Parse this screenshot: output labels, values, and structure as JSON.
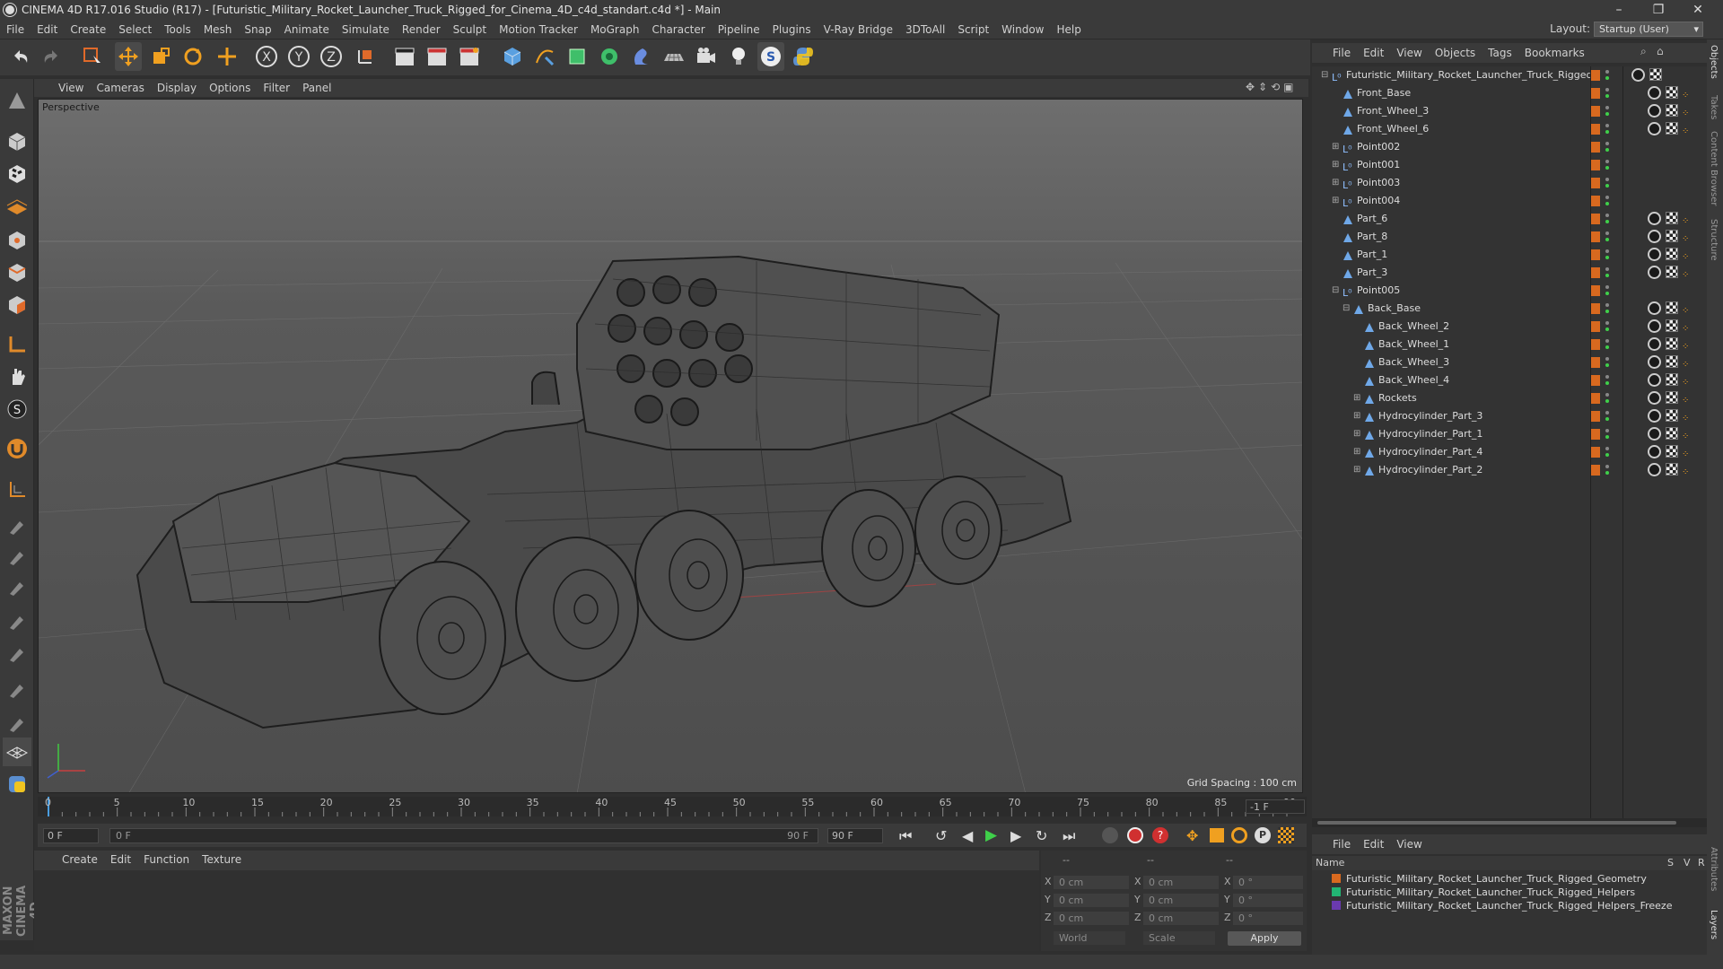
{
  "window": {
    "title": "CINEMA 4D R17.016 Studio (R17) - [Futuristic_Military_Rocket_Launcher_Truck_Rigged_for_Cinema_4D_c4d_standart.c4d *] - Main",
    "minimize": "–",
    "restore": "❐",
    "close": "✕"
  },
  "menubar": [
    "File",
    "Edit",
    "Create",
    "Select",
    "Tools",
    "Mesh",
    "Snap",
    "Animate",
    "Simulate",
    "Render",
    "Sculpt",
    "Motion Tracker",
    "MoGraph",
    "Character",
    "Pipeline",
    "Plugins",
    "V-Ray Bridge",
    "3DToAll",
    "Script",
    "Window",
    "Help"
  ],
  "layout": {
    "label": "Layout:",
    "value": "Startup (User)"
  },
  "viewport": {
    "menu": [
      "View",
      "Cameras",
      "Display",
      "Options",
      "Filter",
      "Panel"
    ],
    "label": "Perspective",
    "grid_spacing": "Grid Spacing : 100 cm"
  },
  "timeline": {
    "ticks": [
      "0",
      "5",
      "10",
      "15",
      "20",
      "25",
      "30",
      "35",
      "40",
      "45",
      "50",
      "55",
      "60",
      "65",
      "70",
      "75",
      "80",
      "85",
      "90"
    ],
    "end_field": "-1 F",
    "current_frame": "0 F",
    "range_start": "0 F",
    "range_end": "90 F",
    "max_frame": "90 F"
  },
  "material_manager": {
    "menu": [
      "Create",
      "Edit",
      "Function",
      "Texture"
    ]
  },
  "coordinates": {
    "headers": [
      "--",
      "--",
      "--"
    ],
    "rows": [
      {
        "axis": "X",
        "pos": "0 cm",
        "size_axis": "X",
        "size": "0 cm",
        "rot_axis": "X",
        "rot": "0 °"
      },
      {
        "axis": "Y",
        "pos": "0 cm",
        "size_axis": "Y",
        "size": "0 cm",
        "rot_axis": "Y",
        "rot": "0 °"
      },
      {
        "axis": "Z",
        "pos": "0 cm",
        "size_axis": "Z",
        "size": "0 cm",
        "rot_axis": "Z",
        "rot": "0 °"
      }
    ],
    "mode": "World",
    "size_mode": "Scale",
    "apply": "Apply"
  },
  "object_manager": {
    "menu": [
      "File",
      "Edit",
      "View",
      "Objects",
      "Tags",
      "Bookmarks"
    ],
    "objects": [
      {
        "name": "Futuristic_Military_Rocket_Launcher_Truck_Rigged",
        "depth": 0,
        "kind": "null"
      },
      {
        "name": "Front_Base",
        "depth": 1,
        "kind": "bone"
      },
      {
        "name": "Front_Wheel_3",
        "depth": 1,
        "kind": "bone"
      },
      {
        "name": "Front_Wheel_6",
        "depth": 1,
        "kind": "bone"
      },
      {
        "name": "Point002",
        "depth": 1,
        "kind": "null"
      },
      {
        "name": "Point001",
        "depth": 1,
        "kind": "null"
      },
      {
        "name": "Point003",
        "depth": 1,
        "kind": "null"
      },
      {
        "name": "Point004",
        "depth": 1,
        "kind": "null"
      },
      {
        "name": "Part_6",
        "depth": 1,
        "kind": "bone"
      },
      {
        "name": "Part_8",
        "depth": 1,
        "kind": "bone"
      },
      {
        "name": "Part_1",
        "depth": 1,
        "kind": "bone"
      },
      {
        "name": "Part_3",
        "depth": 1,
        "kind": "bone"
      },
      {
        "name": "Point005",
        "depth": 1,
        "kind": "null"
      },
      {
        "name": "Back_Base",
        "depth": 2,
        "kind": "bone"
      },
      {
        "name": "Back_Wheel_2",
        "depth": 3,
        "kind": "bone"
      },
      {
        "name": "Back_Wheel_1",
        "depth": 3,
        "kind": "bone"
      },
      {
        "name": "Back_Wheel_3",
        "depth": 3,
        "kind": "bone"
      },
      {
        "name": "Back_Wheel_4",
        "depth": 3,
        "kind": "bone"
      },
      {
        "name": "Rockets",
        "depth": 3,
        "kind": "bone"
      },
      {
        "name": "Hydrocylinder_Part_3",
        "depth": 3,
        "kind": "bone"
      },
      {
        "name": "Hydrocylinder_Part_1",
        "depth": 3,
        "kind": "bone"
      },
      {
        "name": "Hydrocylinder_Part_4",
        "depth": 3,
        "kind": "bone"
      },
      {
        "name": "Hydrocylinder_Part_2",
        "depth": 3,
        "kind": "bone"
      }
    ]
  },
  "layer_manager": {
    "menu": [
      "File",
      "Edit",
      "View"
    ],
    "header": {
      "name": "Name",
      "s": "S",
      "v": "V",
      "r": "R"
    },
    "layers": [
      {
        "name": "Futuristic_Military_Rocket_Launcher_Truck_Rigged_Geometry",
        "color": "#d8691f"
      },
      {
        "name": "Futuristic_Military_Rocket_Launcher_Truck_Rigged_Helpers",
        "color": "#22b573"
      },
      {
        "name": "Futuristic_Military_Rocket_Launcher_Truck_Rigged_Helpers_Freeze",
        "color": "#6a3ab0"
      }
    ]
  },
  "right_tabs": [
    "Objects",
    "Takes",
    "Content Browser",
    "Structure",
    "Attributes",
    "Layers"
  ],
  "branding": "MAXON CINEMA 4D"
}
